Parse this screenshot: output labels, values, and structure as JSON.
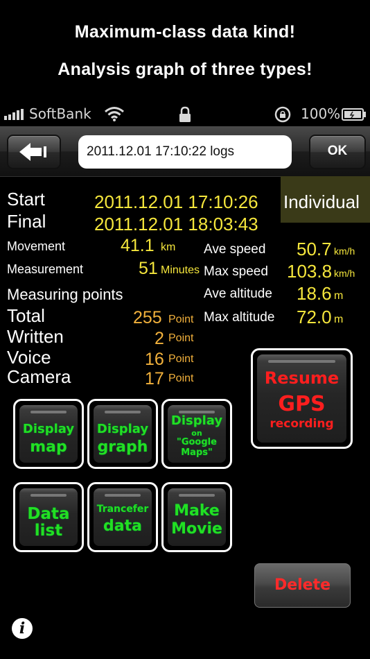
{
  "promo": {
    "line1": "Maximum-class data kind!",
    "line2": "Analysis graph of three types!"
  },
  "status_bar": {
    "carrier": "SoftBank",
    "battery_percent": "100%"
  },
  "nav": {
    "title_field": "2011.12.01 17:10:22 logs",
    "ok_label": "OK"
  },
  "summary": {
    "start_label": "Start",
    "start_value": "2011.12.01 17:10:26",
    "final_label": "Final",
    "final_value": "2011.12.01 18:03:43",
    "individual_label": "Individual",
    "movement_label": "Movement",
    "movement_value": "41.1",
    "movement_unit": "km",
    "measurement_label": "Measurement",
    "measurement_value": "51",
    "measurement_unit": "Minutes",
    "ave_speed_label": "Ave speed",
    "ave_speed_value": "50.7",
    "ave_speed_unit": "km/h",
    "max_speed_label": "Max speed",
    "max_speed_value": "103.8",
    "max_speed_unit": "km/h",
    "ave_alt_label": "Ave altitude",
    "ave_alt_value": "18.6",
    "ave_alt_unit": "m",
    "max_alt_label": "Max altitude",
    "max_alt_value": "72.0",
    "max_alt_unit": "m",
    "points_label": "Measuring points",
    "total_label": "Total",
    "total_value": "255",
    "written_label": "Written",
    "written_value": "2",
    "voice_label": "Voice",
    "voice_value": "16",
    "camera_label": "Camera",
    "camera_value": "17",
    "point_unit": "Point"
  },
  "buttons": {
    "display_map_1": "Display",
    "display_map_2": "map",
    "display_graph_1": "Display",
    "display_graph_2": "graph",
    "google_1": "Display",
    "google_2": "on",
    "google_3": "\"Google",
    "google_4": "Maps\"",
    "data_list_1": "Data",
    "data_list_2": "list",
    "transfer_1": "Trancefer",
    "transfer_2": "data",
    "movie_1": "Make",
    "movie_2": "Movie",
    "resume_1": "Resume",
    "resume_2": "GPS",
    "resume_3": "recording",
    "delete": "Delete"
  },
  "icons": {
    "back": "back-arrow-icon",
    "info": "info-icon",
    "wifi": "wifi-icon",
    "lock": "lock-icon",
    "rotation_lock": "rotation-lock-icon",
    "battery": "battery-icon",
    "signal": "signal-bars-icon"
  },
  "colors": {
    "value_yellow": "#f5e63c",
    "count_orange": "#f2b13c",
    "button_green": "#22e022",
    "button_red": "#ff1e1e",
    "individual_bg": "#3a3a18"
  }
}
